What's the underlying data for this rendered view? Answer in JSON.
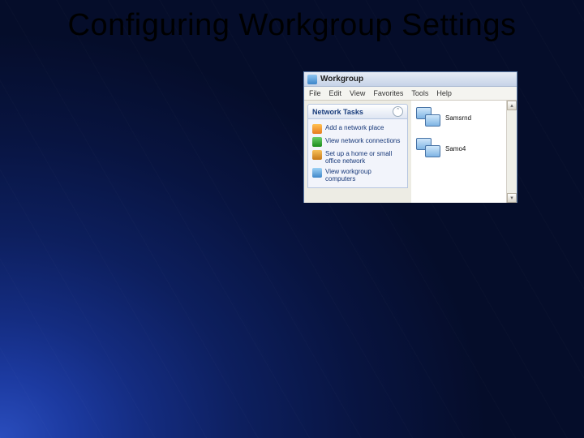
{
  "slide": {
    "title": "Configuring Workgroup Settings"
  },
  "window": {
    "title": "Workgroup",
    "menu": {
      "file": "File",
      "edit": "Edit",
      "view": "View",
      "favorites": "Favorites",
      "tools": "Tools",
      "help": "Help"
    },
    "sidebar": {
      "header": "Network Tasks",
      "collapse_glyph": "ˆ",
      "items": {
        "add": "Add a network place",
        "view_conn": "View network connections",
        "setup": "Set up a home or small office network",
        "view_wg": "View workgroup computers"
      }
    },
    "content": {
      "items": {
        "c0": "Samsrnd",
        "c1": "Samo4"
      }
    },
    "scroll": {
      "up": "▴",
      "down": "▾"
    }
  }
}
